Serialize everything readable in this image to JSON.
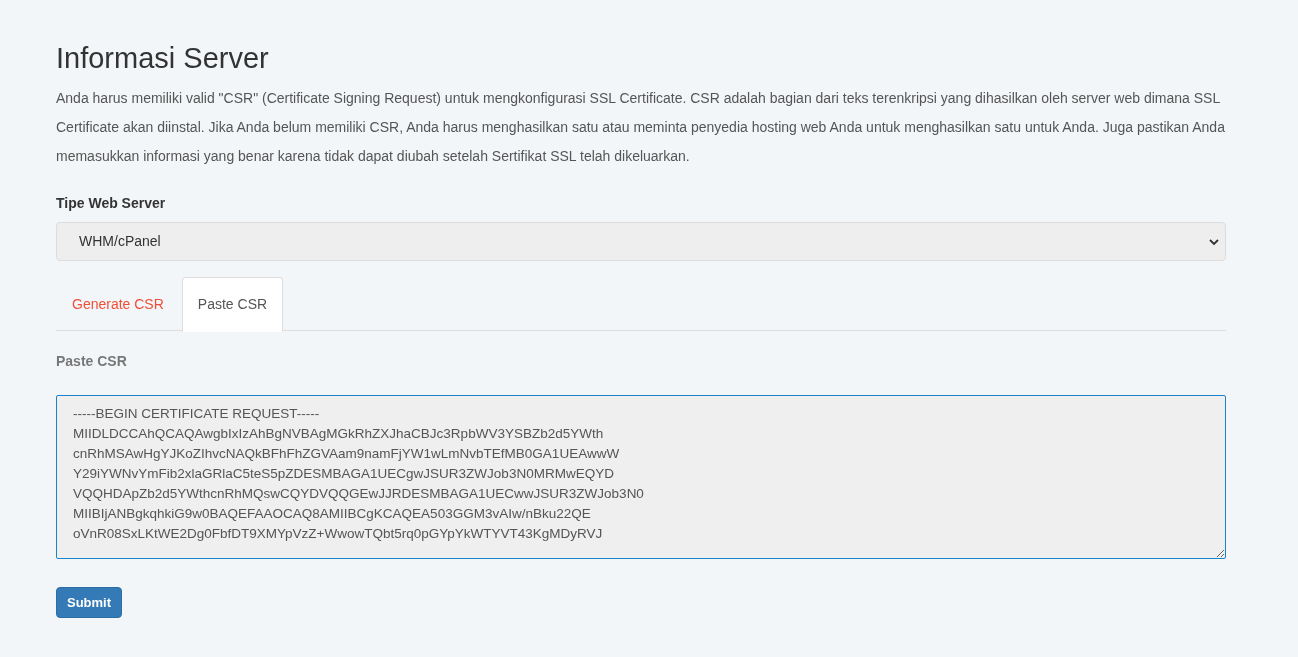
{
  "title": "Informasi Server",
  "intro": "Anda harus memiliki valid \"CSR\" (Certificate Signing Request) untuk mengkonfigurasi SSL Certificate. CSR adalah bagian dari teks terenkripsi yang dihasilkan oleh server web dimana SSL Certificate akan diinstal. Jika Anda belum memiliki CSR, Anda harus menghasilkan satu atau meminta penyedia hosting web Anda untuk menghasilkan satu untuk Anda. Juga pastikan Anda memasukkan informasi yang benar karena tidak dapat diubah setelah Sertifikat SSL telah dikeluarkan.",
  "server_type": {
    "label": "Tipe Web Server",
    "value": "WHM/cPanel"
  },
  "tabs": [
    {
      "label": "Generate CSR",
      "selected": false
    },
    {
      "label": "Paste CSR",
      "selected": true
    }
  ],
  "csr": {
    "label": "Paste CSR",
    "lines": [
      "-----BEGIN CERTIFICATE REQUEST-----",
      "MIIDLDCCAhQCAQAwgbIxIzAhBgNVBAgMGkRhZXJhaCBJc3RpbWV3YSBZb2d5YWth",
      "cnRhMSAwHgYJKoZIhvcNAQkBFhFhZGVAam9namFjYW1wLmNvbTEfMB0GA1UEAwwW",
      "Y29iYWNvYmFib2xlaGRlaC5teS5pZDESMBAGA1UECgwJSUR3ZWJob3N0MRMwEQYD",
      "VQQHDApZb2d5YWthcnRhMQswCQYDVQQGEwJJRDESMBAGA1UECwwJSUR3ZWJob3N0",
      "MIIBIjANBgkqhkiG9w0BAQEFAAOCAQ8AMIIBCgKCAQEA503GGM3vAIw/nBku22QE",
      "oVnR08SxLKtWE2Dg0FbfDT9XMYpVzZ+WwowTQbt5rq0pGYpYkWTYVT43KgMDyRVJ"
    ]
  },
  "submit": "Submit"
}
